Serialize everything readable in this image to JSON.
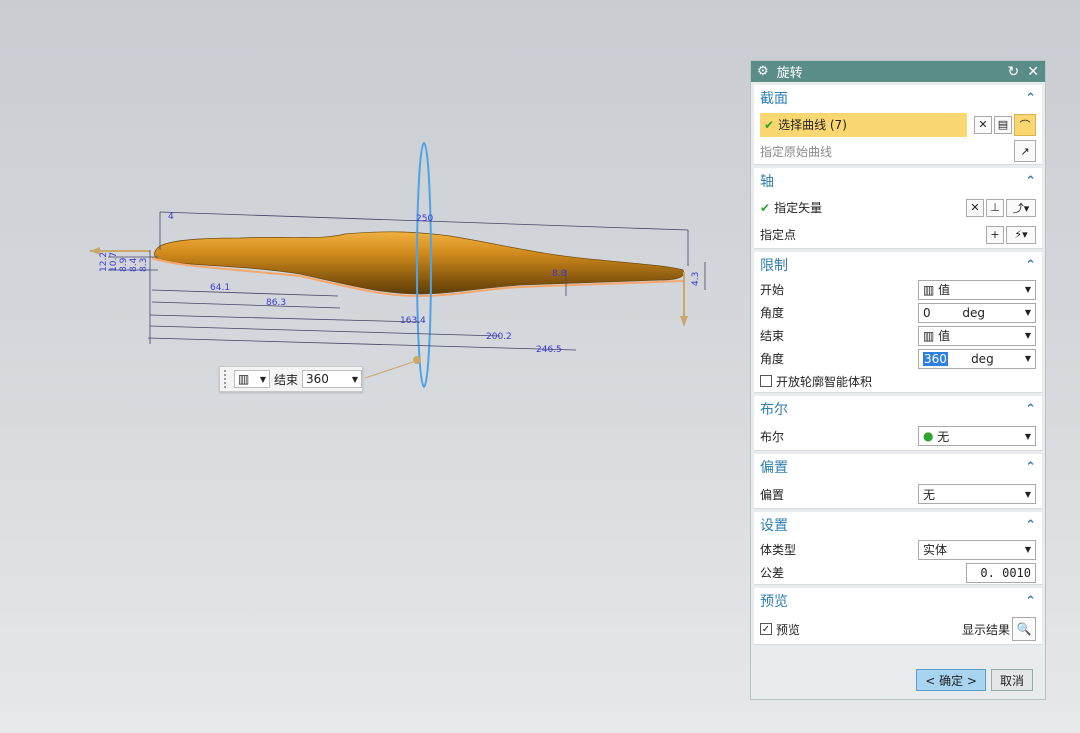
{
  "dimensions": {
    "overall_length": "250",
    "tip": "4",
    "d1": "64.1",
    "d2": "86.3",
    "d3": "163.4",
    "d4": "200.2",
    "d5": "246.5",
    "left_heights": [
      "12.2",
      "10.7",
      "8.9",
      "8.4",
      "8.3"
    ],
    "mid_h": "8.8",
    "right_h": "4.3"
  },
  "mini_toolbar": {
    "end_label": "结束",
    "end_value": "360"
  },
  "dialog": {
    "title": "旋转",
    "sections": {
      "section": {
        "header": "截面",
        "select_curve": "选择曲线 (7)",
        "specify_original": "指定原始曲线"
      },
      "axis": {
        "header": "轴",
        "specify_vector": "指定矢量",
        "specify_point": "指定点"
      },
      "limits": {
        "header": "限制",
        "start_label": "开始",
        "start_type": "值",
        "start_angle_label": "角度",
        "start_angle": "0",
        "start_unit": "deg",
        "end_label": "结束",
        "end_type": "值",
        "end_angle_label": "角度",
        "end_angle": "360",
        "end_unit": "deg",
        "open_profile": "开放轮廓智能体积"
      },
      "boolean": {
        "header": "布尔",
        "label": "布尔",
        "value": "无"
      },
      "offset": {
        "header": "偏置",
        "label": "偏置",
        "value": "无"
      },
      "settings": {
        "header": "设置",
        "body_type_label": "体类型",
        "body_type": "实体",
        "tolerance_label": "公差",
        "tolerance": "0. 0010"
      },
      "preview": {
        "header": "预览",
        "preview_label": "预览",
        "show_result": "显示结果"
      }
    },
    "ok": "< 确定 >",
    "cancel": "取消"
  }
}
